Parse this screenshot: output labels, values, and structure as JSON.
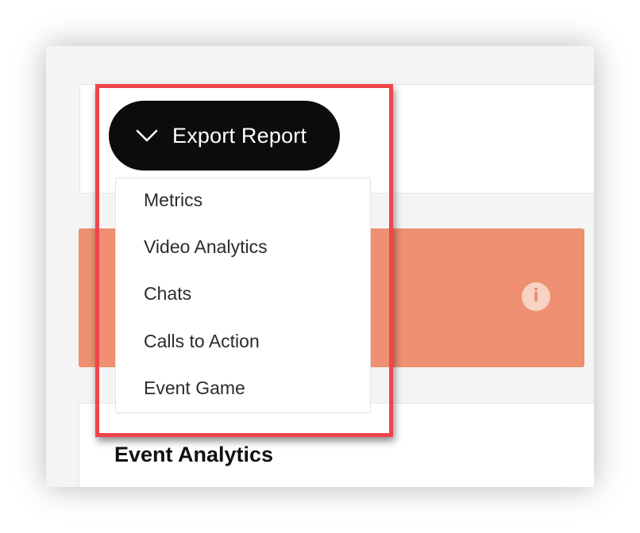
{
  "export_button": {
    "label": "Export Report",
    "icon": "chevron-down-icon"
  },
  "export_menu": {
    "items": [
      {
        "label": "Metrics"
      },
      {
        "label": "Video Analytics"
      },
      {
        "label": "Chats"
      },
      {
        "label": "Calls to Action"
      },
      {
        "label": "Event Game"
      }
    ]
  },
  "alert_banner": {
    "icon": "info-icon",
    "icon_glyph": "i"
  },
  "analytics_section": {
    "title": "Event Analytics"
  },
  "colors": {
    "button_background": "#0c0c0c",
    "alert_background": "#ee9071",
    "highlight_border": "#f2434a",
    "page_background": "#f4f4f4"
  }
}
